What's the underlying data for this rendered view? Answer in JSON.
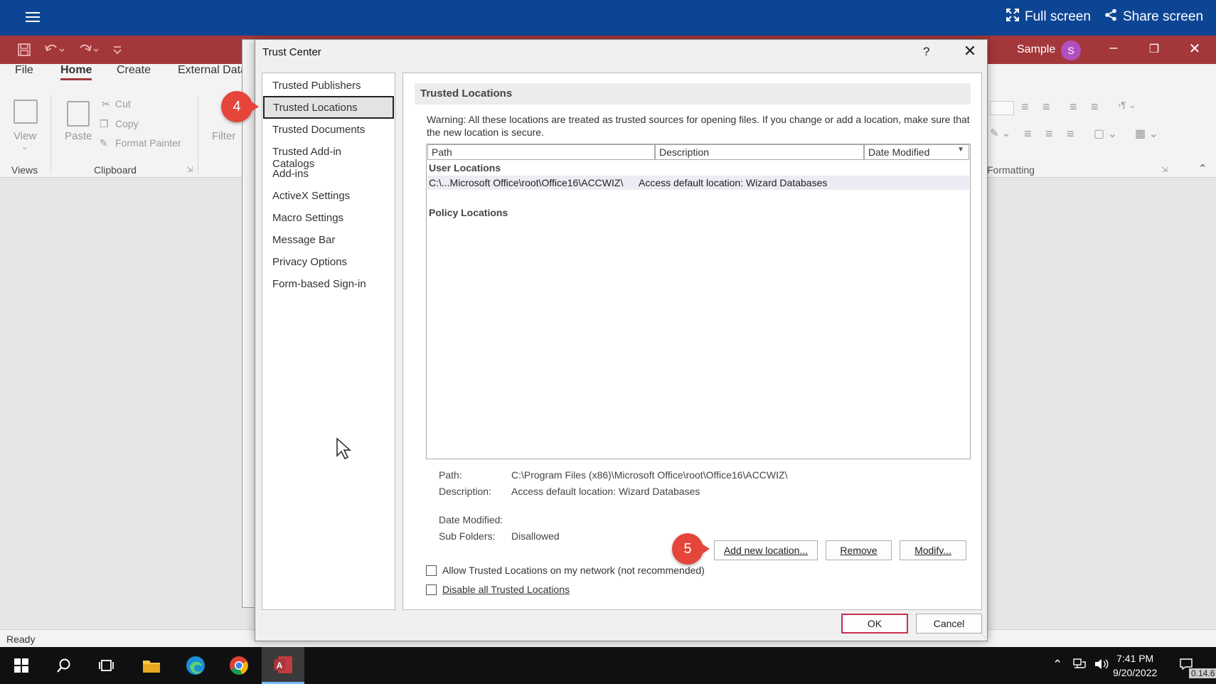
{
  "presenter": {
    "full_screen": "Full screen",
    "share_screen": "Share screen"
  },
  "access": {
    "user_name": "Sample",
    "user_initial": "S",
    "tabs": [
      "File",
      "Home",
      "Create",
      "External Data"
    ],
    "ribbon": {
      "view": "View",
      "views_group": "Views",
      "paste": "Paste",
      "cut": "Cut",
      "copy": "Copy",
      "format_painter": "Format Painter",
      "clipboard_group": "Clipboard",
      "filter": "Filter",
      "formatting_group": "Formatting"
    },
    "status": "Ready"
  },
  "dialog": {
    "title": "Trust Center",
    "help": "?",
    "nav": [
      "Trusted Publishers",
      "Trusted Locations",
      "Trusted Documents",
      "Trusted Add-in Catalogs",
      "Add-ins",
      "ActiveX Settings",
      "Macro Settings",
      "Message Bar",
      "Privacy Options",
      "Form-based Sign-in"
    ],
    "selected_nav": "Trusted Locations",
    "section_title": "Trusted Locations",
    "warning": "Warning: All these locations are treated as trusted sources for opening files.  If you change or add a location, make sure that the new location is secure.",
    "columns": {
      "path": "Path",
      "description": "Description",
      "date_modified": "Date Modified"
    },
    "user_locations_label": "User Locations",
    "row": {
      "path": "C:\\...Microsoft Office\\root\\Office16\\ACCWIZ\\",
      "description": "Access default location: Wizard Databases"
    },
    "policy_locations_label": "Policy Locations",
    "details": {
      "path_label": "Path:",
      "path_value": "C:\\Program Files (x86)\\Microsoft Office\\root\\Office16\\ACCWIZ\\",
      "description_label": "Description:",
      "description_value": "Access default location: Wizard Databases",
      "date_modified_label": "Date Modified:",
      "sub_folders_label": "Sub Folders:",
      "sub_folders_value": "Disallowed"
    },
    "buttons": {
      "add_new": "Add new location...",
      "remove": "Remove",
      "modify": "Modify...",
      "ok": "OK",
      "cancel": "Cancel"
    },
    "checkboxes": {
      "allow_network": "Allow Trusted Locations on my network (not recommended)",
      "disable_all": "Disable all Trusted Locations"
    }
  },
  "steps": {
    "step4": "4",
    "step5": "5"
  },
  "taskbar": {
    "time": "7:41 PM",
    "date": "9/20/2022",
    "version": "0.14.6"
  }
}
